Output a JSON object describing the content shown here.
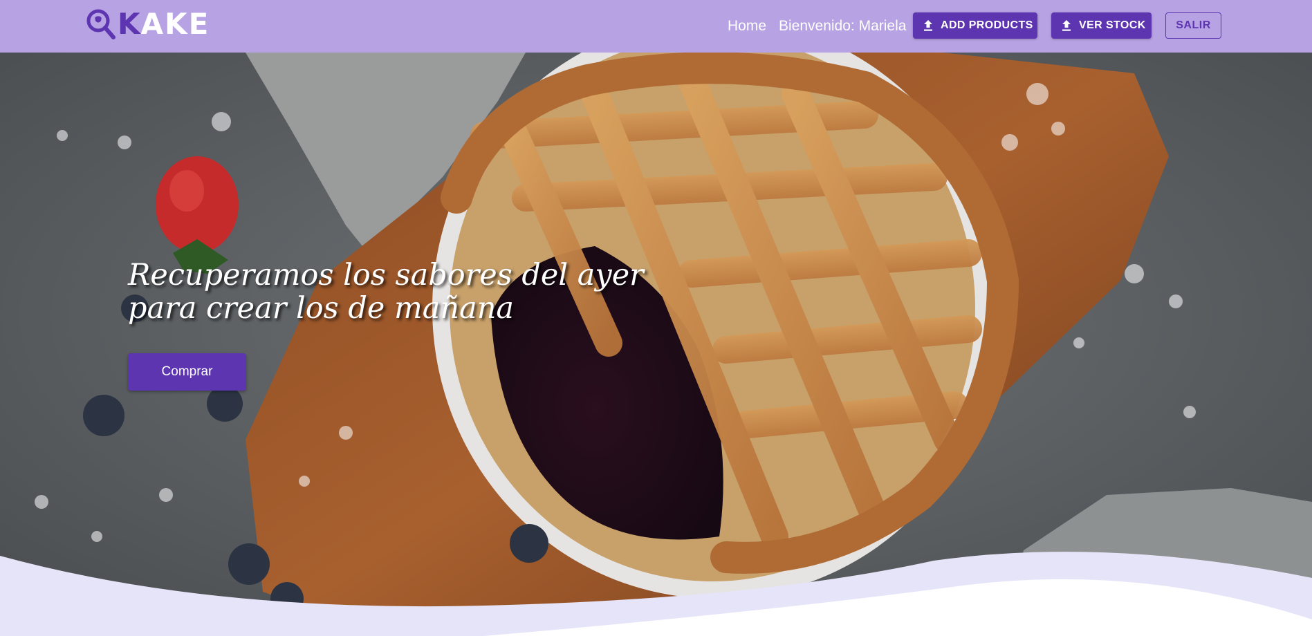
{
  "brand": {
    "logo_icon": "map-pin-search-icon",
    "logo_letter": "K",
    "logo_rest": "AKE",
    "color_accent": "#5e35b1",
    "color_navbar": "#b7a2e3",
    "color_wave": "#e6e4f8"
  },
  "nav": {
    "home": "Home",
    "welcome": "Bienvenido: Mariela",
    "add_products": "ADD PRODUCTS",
    "ver_stock": "VER STOCK",
    "salir": "SALIR",
    "button_icon": "upload-icon"
  },
  "hero": {
    "title_line1": "Recuperamos los sabores del ayer",
    "title_line2": "para crear los de mañana",
    "cta": "Comprar"
  }
}
